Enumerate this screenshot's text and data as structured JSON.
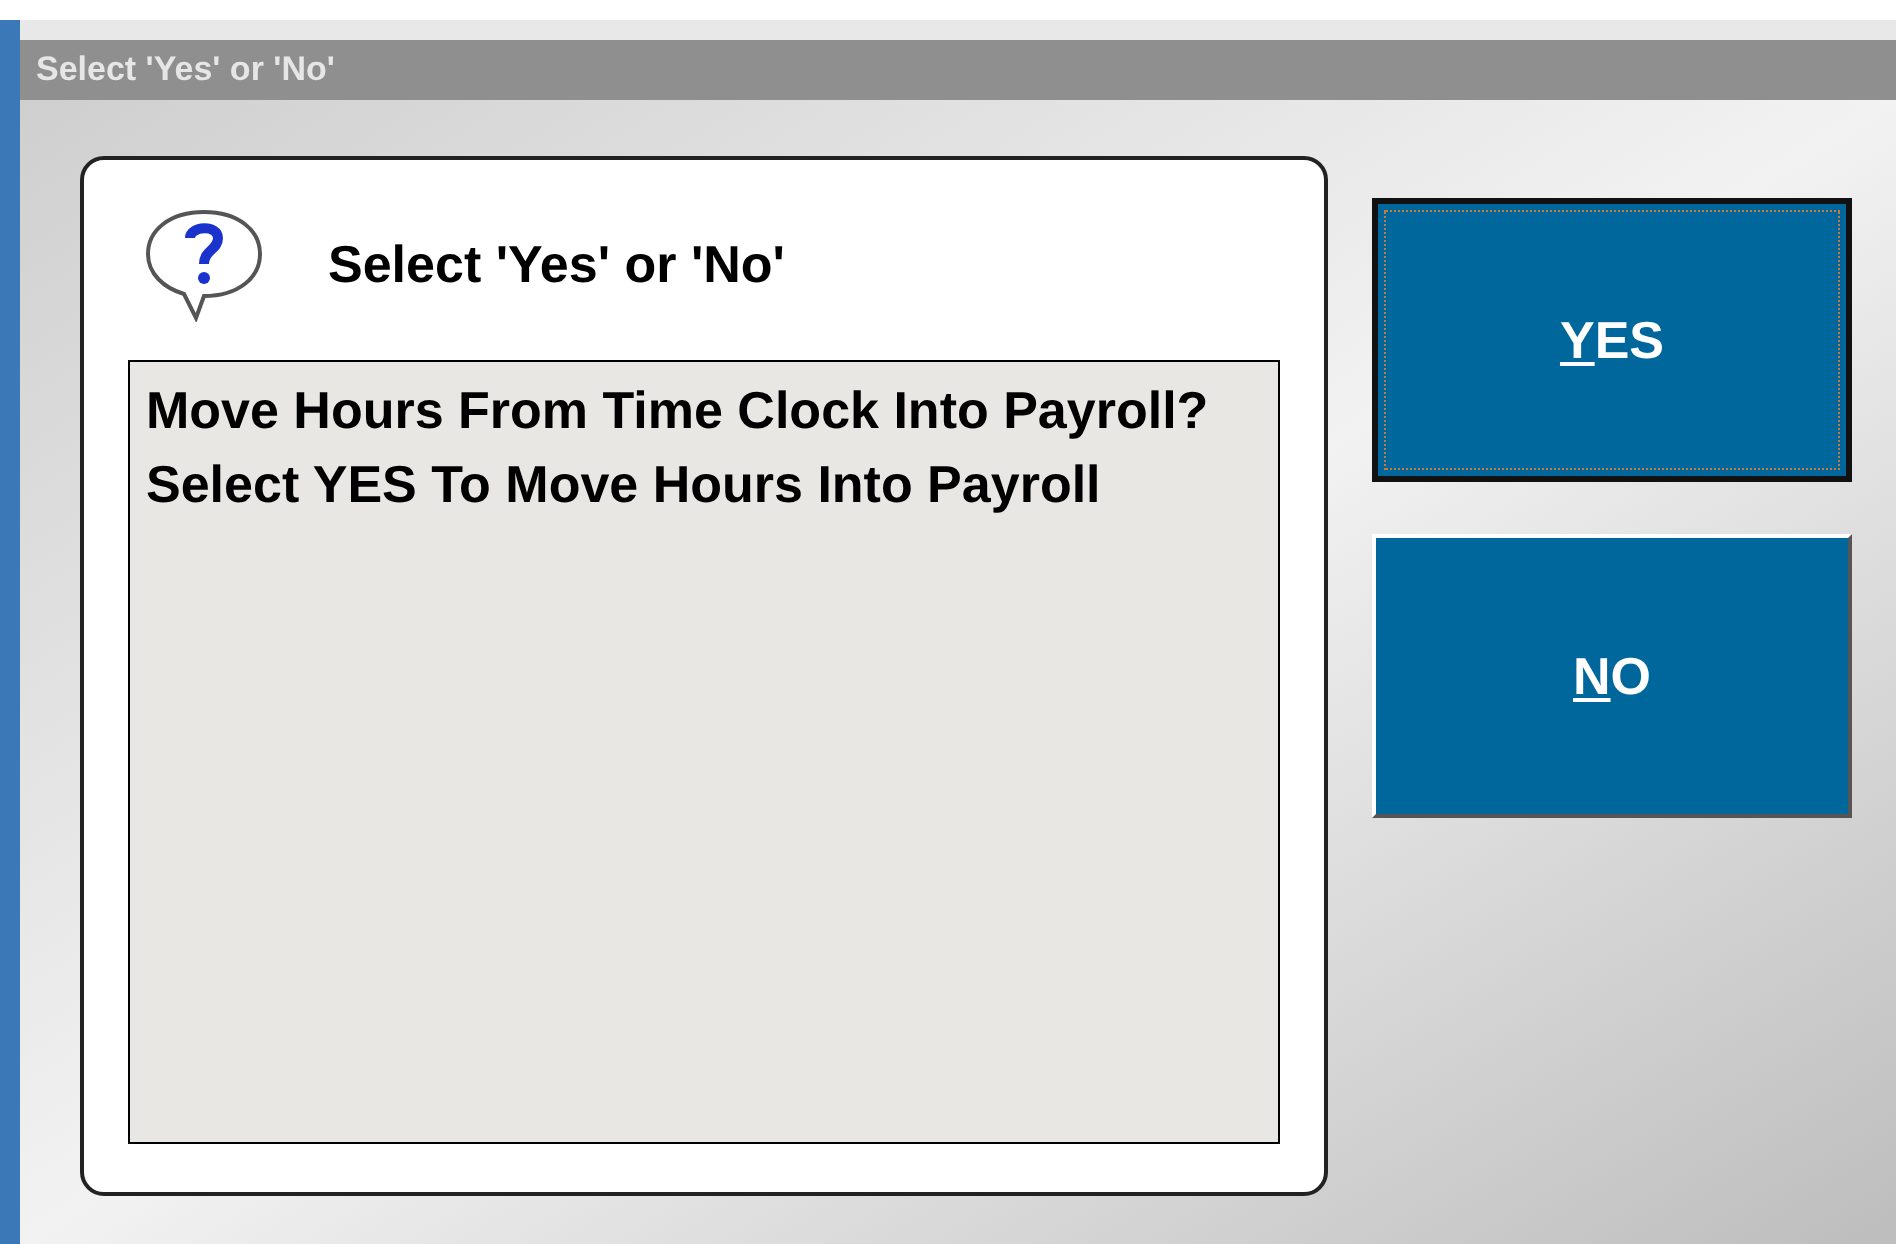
{
  "window": {
    "title": "Select 'Yes' or 'No'"
  },
  "dialog": {
    "heading": "Select 'Yes' or 'No'",
    "message": "Move Hours From Time Clock Into Payroll? Select YES To Move Hours Into Payroll"
  },
  "buttons": [
    {
      "label": "YES",
      "focused": true
    },
    {
      "label": "NO",
      "focused": false
    }
  ]
}
